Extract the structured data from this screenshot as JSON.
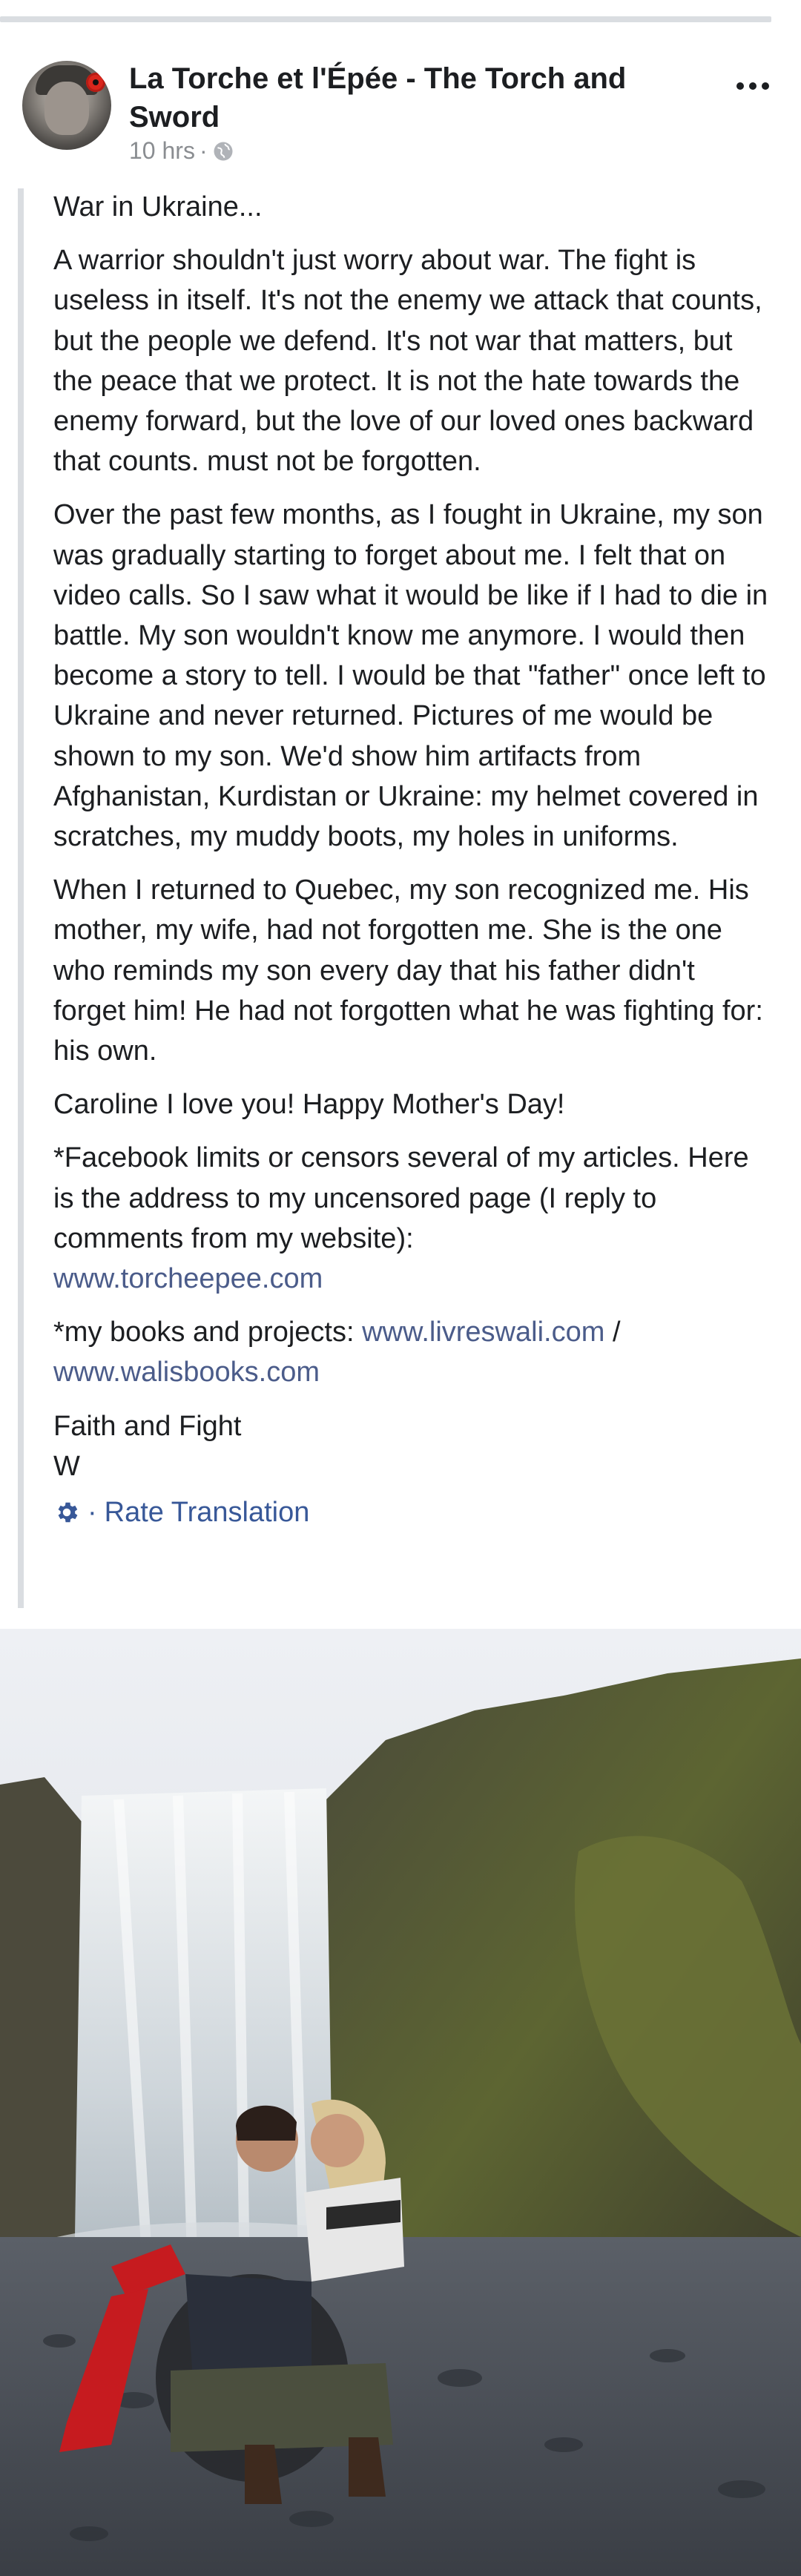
{
  "post": {
    "page_name": "La Torche et l'Épée - The Torch and Sword",
    "timestamp": "10 hrs",
    "separator": "·",
    "paragraphs": [
      "War in Ukraine...",
      "A warrior shouldn't just worry about war. The fight is useless in itself. It's not the enemy we attack that counts, but the people we defend. It's not war that matters, but the peace that we protect. It is not the hate towards the enemy forward, but the love of our loved ones backward that counts. must not be forgotten.",
      "Over the past few months, as I fought in Ukraine, my son was gradually starting to forget about me. I felt that on video calls. So I saw what it would be like if I had to die in battle. My son wouldn't know me anymore. I would then become a story to tell. I would be that \"father\" once left to Ukraine and never returned. Pictures of me would be shown to my son. We'd show him artifacts from Afghanistan, Kurdistan or Ukraine: my helmet covered in scratches, my muddy boots, my holes in uniforms.",
      "When I returned to Quebec, my son recognized me. His mother, my wife, had not forgotten me. She is the one who reminds my son every day that his father didn't forget him! He had not forgotten what he was fighting for: his own.",
      "Caroline I love you! Happy Mother's Day!"
    ],
    "facebook_note": "*Facebook limits or censors several of my articles. Here is the address to my uncensored page (I reply to comments from my website):",
    "website_link": "www.torcheepee.com",
    "books_label": "*my books and projects:",
    "books_link_1": "www.livreswali.com",
    "books_sep": "/",
    "books_link_2": "www.walisbooks.com",
    "signoff_line1": "Faith and Fight",
    "signoff_line2": "W",
    "translation_sep": "·",
    "rate_translation": "Rate Translation"
  },
  "icons": {
    "more": "more-horizontal-icon",
    "audience": "globe-icon",
    "translation": "gear-icon"
  },
  "colors": {
    "text": "#1c1e21",
    "secondary_text": "#8a8d91",
    "link": "#4b5c8a",
    "translation_link": "#385898",
    "quote_bar": "#dadde1"
  }
}
